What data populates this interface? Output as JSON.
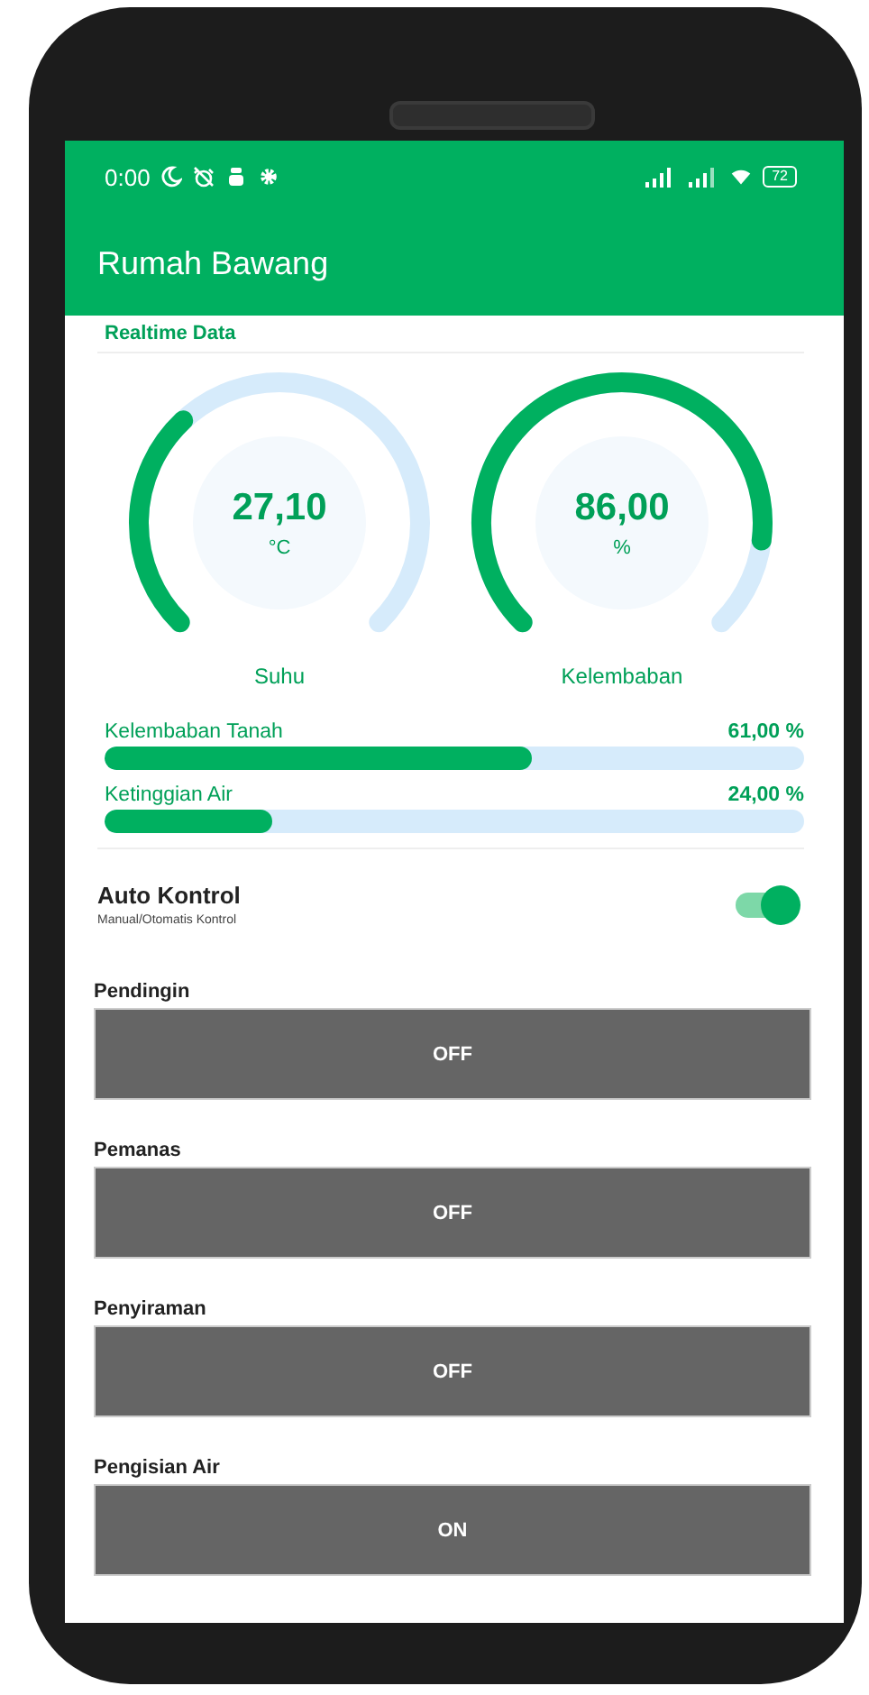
{
  "status_bar": {
    "time": "0:00",
    "battery": "72"
  },
  "app_bar": {
    "title": "Rumah Bawang"
  },
  "section_title": "Realtime Data",
  "gauges": [
    {
      "value": "27,10",
      "unit": "°C",
      "label": "Suhu"
    },
    {
      "value": "86,00",
      "unit": "%",
      "label": "Kelembaban"
    }
  ],
  "bars": [
    {
      "label": "Kelembaban Tanah",
      "reading": "61,00 %",
      "level": 0.61
    },
    {
      "label": "Ketinggian Air",
      "reading": "24,00 %",
      "level": 0.24
    }
  ],
  "auto_control": {
    "title": "Auto Kontrol",
    "subtitle": "Manual/Otomatis Kontrol",
    "on": true
  },
  "controls": [
    {
      "label": "Pendingin",
      "button": "OFF"
    },
    {
      "label": "Pemanas",
      "button": "OFF"
    },
    {
      "label": "Penyiraman",
      "button": "OFF"
    },
    {
      "label": "Pengisian Air",
      "button": "ON"
    }
  ]
}
